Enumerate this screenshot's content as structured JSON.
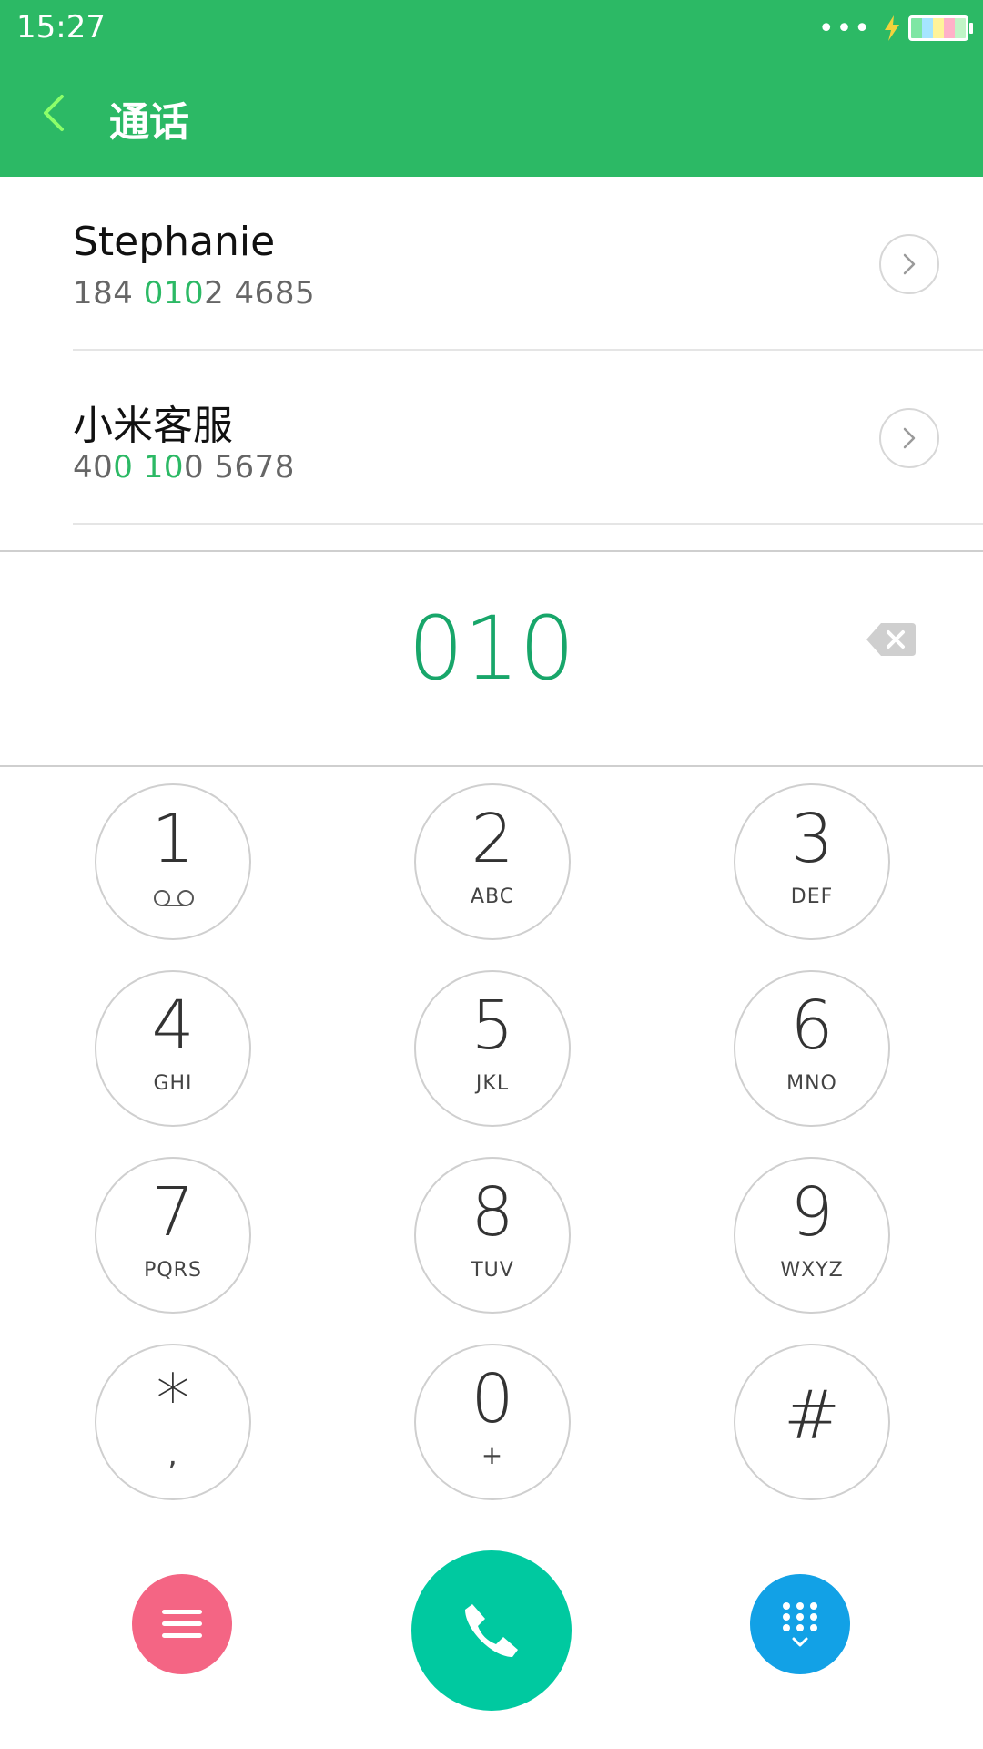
{
  "status_bar": {
    "time": "15:27",
    "signal_text": "•••"
  },
  "header": {
    "title": "通话",
    "back_icon": "chevron-left-icon"
  },
  "contacts": [
    {
      "name": "Stephanie",
      "number_parts": [
        "184 ",
        "010",
        "2 4685"
      ]
    },
    {
      "name": "小米客服",
      "number_parts": [
        "40",
        "0 10",
        "0 5678"
      ]
    }
  ],
  "dial": {
    "number": "010",
    "backspace_icon": "backspace-icon"
  },
  "keypad": {
    "keys": [
      {
        "digit": "1",
        "letters": ""
      },
      {
        "digit": "2",
        "letters": "ABC"
      },
      {
        "digit": "3",
        "letters": "DEF"
      },
      {
        "digit": "4",
        "letters": "GHI"
      },
      {
        "digit": "5",
        "letters": "JKL"
      },
      {
        "digit": "6",
        "letters": "MNO"
      },
      {
        "digit": "7",
        "letters": "PQRS"
      },
      {
        "digit": "8",
        "letters": "TUV"
      },
      {
        "digit": "9",
        "letters": "WXYZ"
      },
      {
        "digit": "*",
        "letters": ","
      },
      {
        "digit": "0",
        "letters": "+"
      },
      {
        "digit": "#",
        "letters": ""
      }
    ]
  },
  "colors": {
    "header": "#2CB965",
    "accent_green": "#18A66A",
    "call": "#00C9A0",
    "menu": "#F46584",
    "keypad_toggle": "#12A1E6"
  },
  "icons": {
    "menu": "menu-icon",
    "call": "phone-icon",
    "keypad_toggle": "dialpad-icon"
  }
}
